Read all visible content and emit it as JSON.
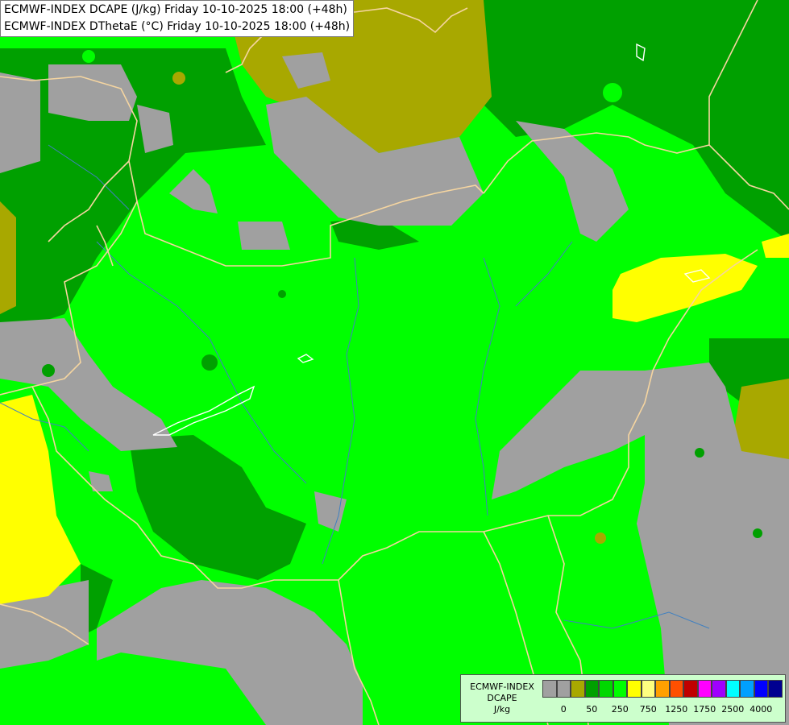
{
  "title": {
    "line1": "ECMWF-INDEX DCAPE (J/kg) Friday 10-10-2025 18:00 (+48h)",
    "line2": "ECMWF-INDEX DThetaE (°C) Friday 10-10-2025 18:00 (+48h)"
  },
  "legend": {
    "model": "ECMWF-INDEX",
    "parameter": "DCAPE",
    "unit": "J/kg",
    "colors": [
      "#a0a0a0",
      "#a0a0a0",
      "#a8a800",
      "#00a000",
      "#00d800",
      "#00ff00",
      "#ffff00",
      "#ffff80",
      "#ffa000",
      "#ff5000",
      "#c00000",
      "#ff00ff",
      "#a000ff",
      "#00ffff",
      "#00a0ff",
      "#0000ff",
      "#000090"
    ],
    "ticks": [
      "0",
      "50",
      "250",
      "750",
      "1250",
      "1750",
      "2500",
      "4000"
    ]
  },
  "palette": {
    "gray": "#a0a0a0",
    "olive": "#a8a800",
    "dark_green": "#00a000",
    "green": "#00ff00",
    "yellow": "#ffff00",
    "border": "#f5d5a0",
    "river": "#4080c0"
  }
}
